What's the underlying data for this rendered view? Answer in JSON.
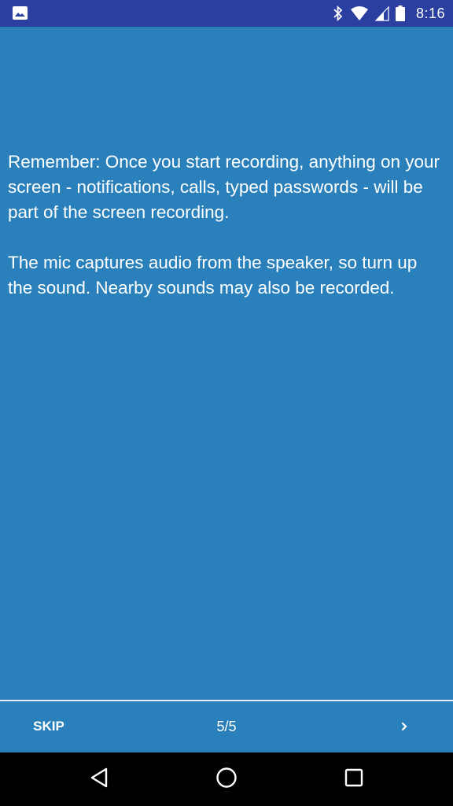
{
  "status_bar": {
    "time": "8:16",
    "icons": [
      "image-icon",
      "bluetooth-icon",
      "wifi-icon",
      "cell-signal-icon",
      "battery-icon"
    ]
  },
  "content": {
    "paragraph_1": "Remember: Once you start recording, anything on your screen - notifications, calls, typed passwords - will be part of the screen recording.",
    "paragraph_2": "The mic captures audio from the speaker, so turn up the sound. Nearby sounds may also be recorded."
  },
  "footer": {
    "skip_label": "SKIP",
    "page_indicator": "5/5",
    "next_icon": "chevron-right-icon"
  },
  "nav_bar": {
    "icons": [
      "back-icon",
      "home-icon",
      "recents-icon"
    ]
  },
  "colors": {
    "background": "#2a80bb",
    "status_bar": "#2a3fa0",
    "text": "#ffffff",
    "nav_bar": "#000000"
  }
}
